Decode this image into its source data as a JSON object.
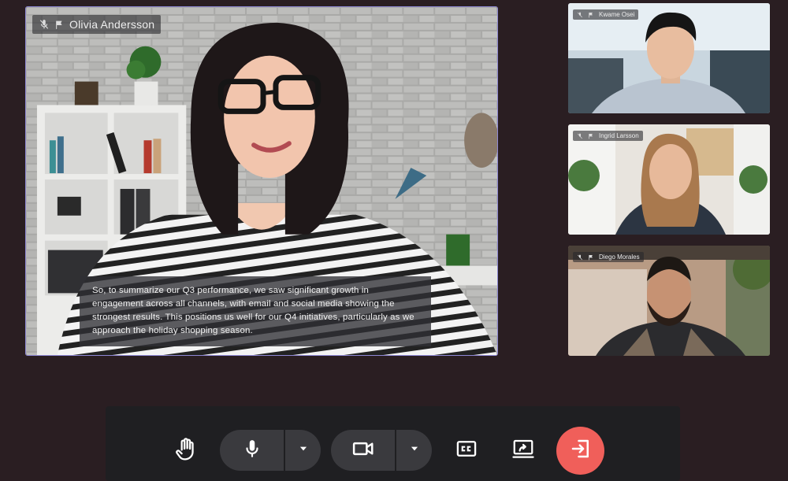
{
  "main_speaker": {
    "name": "Olivia Andersson",
    "caption": "So, to summarize our Q3 performance, we saw significant growth in engagement across all channels, with email and social media showing the strongest results. This positions us well for our Q4 initiatives, particularly as we approach the holiday shopping season.",
    "icons": [
      "mic-off-icon",
      "flag-icon"
    ]
  },
  "participants": [
    {
      "name": "Kwame Osei"
    },
    {
      "name": "Ingrid Larsson"
    },
    {
      "name": "Diego Morales"
    }
  ],
  "controls": {
    "raise_hand": "hand-icon",
    "microphone": "mic-icon",
    "camera": "video-icon",
    "captions": "cc-icon",
    "present": "present-screen-icon",
    "leave": "leave-icon"
  },
  "colors": {
    "background": "#2a1e22",
    "control_bar": "#1f1f22",
    "control_pill": "#3a3a3e",
    "leave_button": "#f05f5a",
    "active_speaker_border": "#8e88d4"
  }
}
